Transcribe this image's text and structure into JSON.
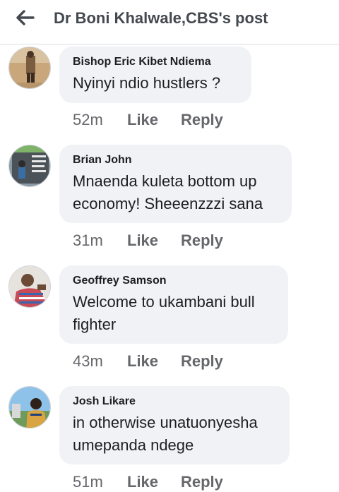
{
  "header": {
    "title": "Dr Boni Khalwale,CBS's post",
    "back_icon": "arrow-left-icon"
  },
  "comments": [
    {
      "author": "Bishop Eric Kibet Ndiema",
      "text": "Nyinyi ndio hustlers ?",
      "time": "52m",
      "like": "Like",
      "reply": "Reply"
    },
    {
      "author": "Brian John",
      "text": "Mnaenda kuleta bottom up economy! Sheeenzzzi sana",
      "time": "31m",
      "like": "Like",
      "reply": "Reply"
    },
    {
      "author": "Geoffrey Samson",
      "text": "Welcome to ukambani bull fighter",
      "time": "43m",
      "like": "Like",
      "reply": "Reply"
    },
    {
      "author": "Josh Likare",
      "text": "in otherwise unatuonyesha umepanda  ndege",
      "time": "51m",
      "like": "Like",
      "reply": "Reply"
    }
  ],
  "colors": {
    "bubble": "#f0f2f5",
    "secondary_text": "#65676b",
    "primary_text": "#1c1e21"
  }
}
